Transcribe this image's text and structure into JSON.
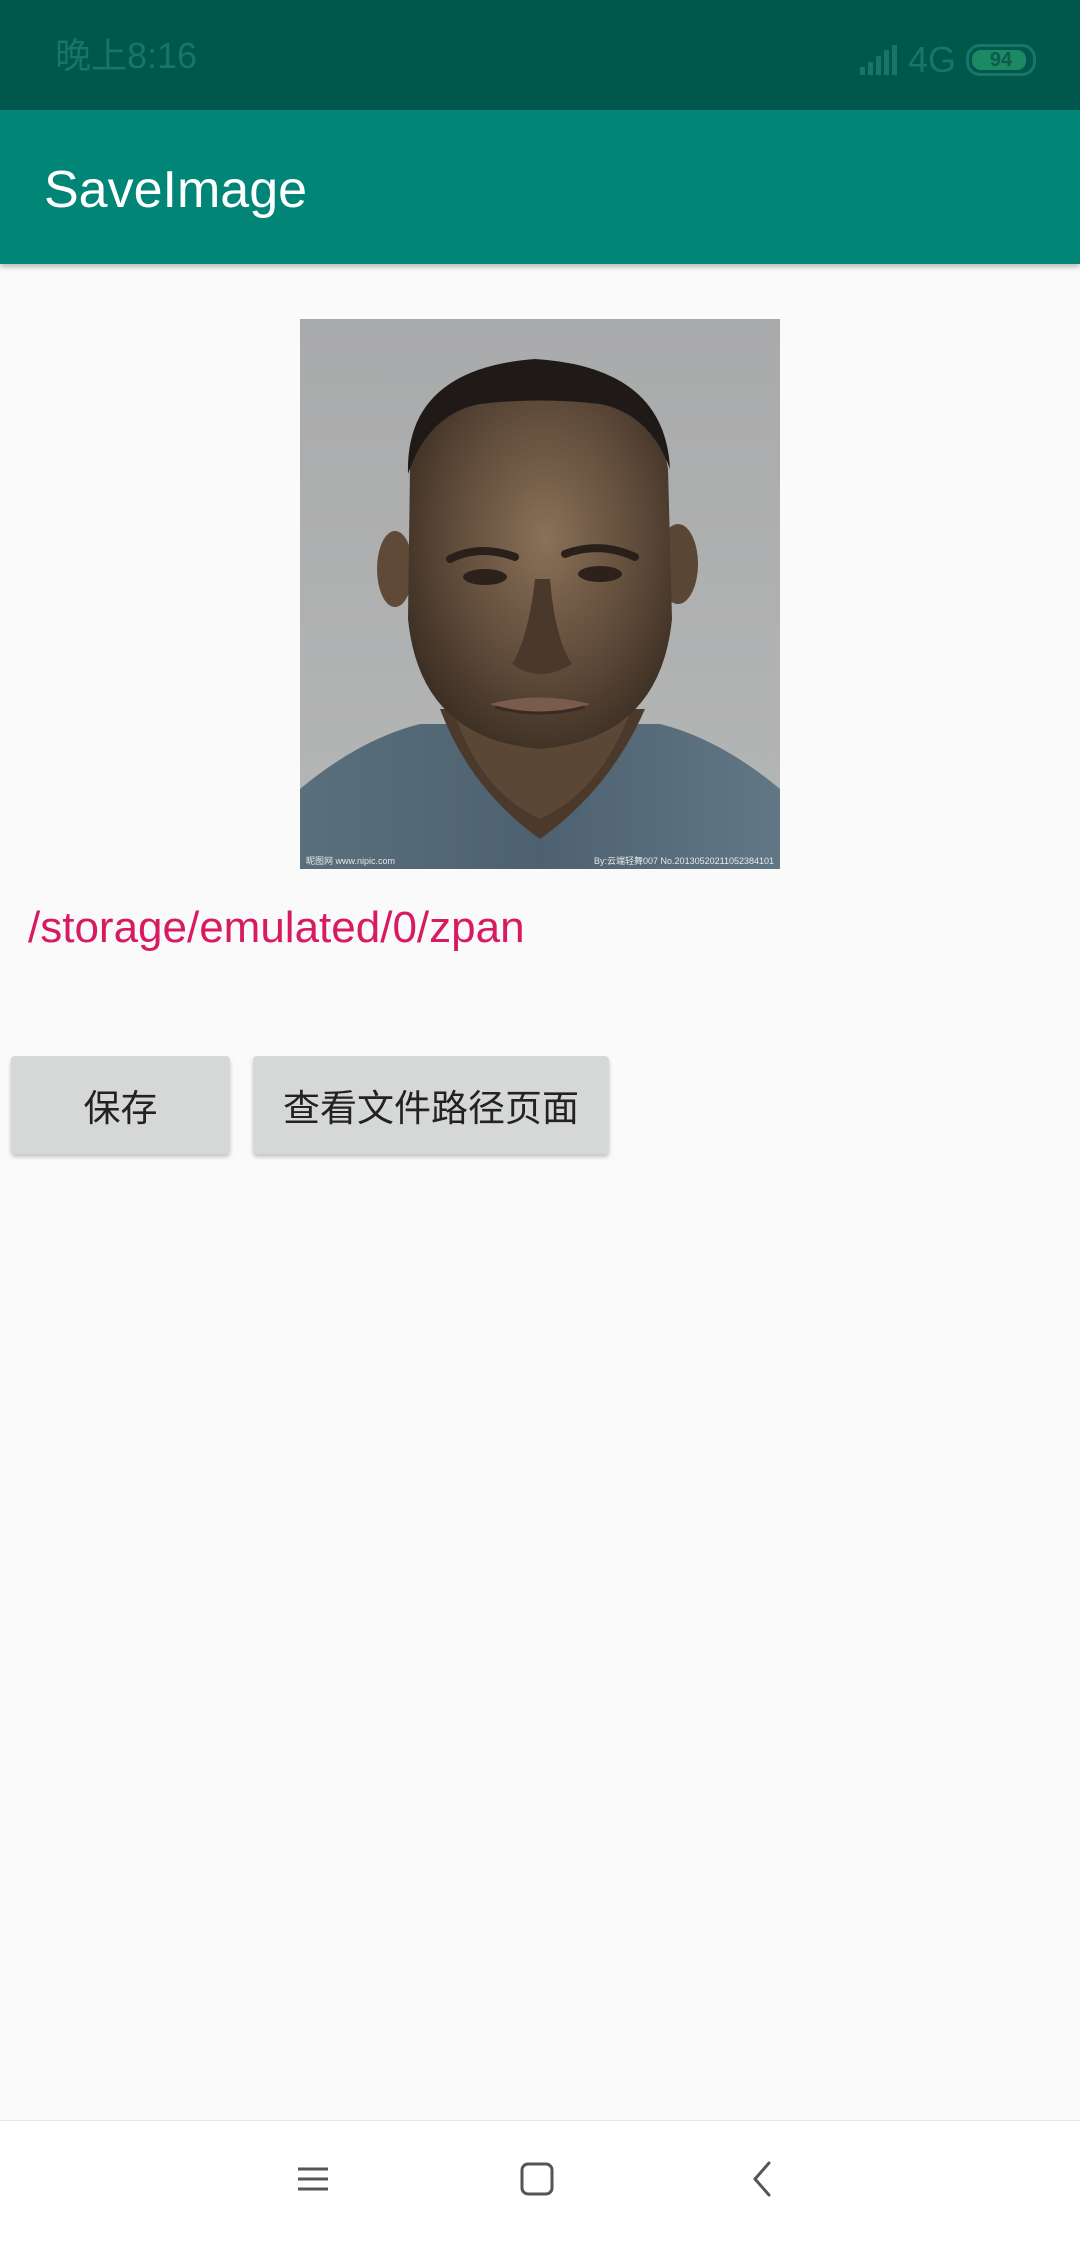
{
  "status_bar": {
    "time": "晚上8:16",
    "network": "4G",
    "battery_level": "94",
    "battery_fraction": 0.94,
    "icons": [
      "signal-icon",
      "battery-icon"
    ]
  },
  "app_bar": {
    "title": "SaveImage"
  },
  "image": {
    "watermark_left": "昵图网 www.nipic.com",
    "watermark_right": "By:云端轻舞007 No.20130520211052384101"
  },
  "path_text": "/storage/emulated/0/zpan",
  "buttons": {
    "save_label": "保存",
    "view_label": "查看文件路径页面"
  },
  "nav_bar": {
    "icons": [
      "menu-icon",
      "home-icon",
      "back-icon"
    ]
  },
  "colors": {
    "status_bar": "#00574b",
    "app_bar": "#008577",
    "accent": "#d81b60",
    "background": "#fafafa",
    "button": "#d6d7d7"
  }
}
